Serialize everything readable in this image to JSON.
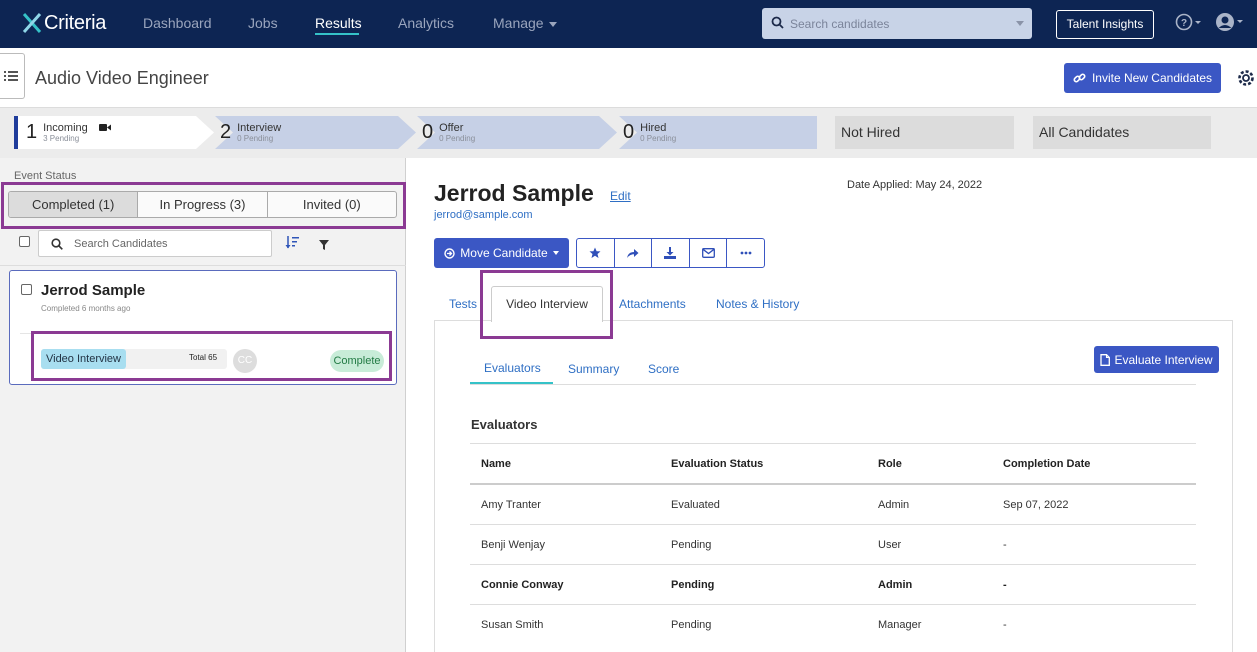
{
  "nav": {
    "brand": "Criteria",
    "items": [
      "Dashboard",
      "Jobs",
      "Results",
      "Analytics",
      "Manage"
    ],
    "active": "Results",
    "search_placeholder": "Search candidates",
    "talent_insights": "Talent Insights"
  },
  "header": {
    "title": "Audio Video Engineer",
    "invite_label": "Invite New Candidates"
  },
  "pipeline": {
    "stages": [
      {
        "count": "1",
        "label": "Incoming",
        "sub": "3 Pending"
      },
      {
        "count": "2",
        "label": "Interview",
        "sub": "0 Pending"
      },
      {
        "count": "0",
        "label": "Offer",
        "sub": "0 Pending"
      },
      {
        "count": "0",
        "label": "Hired",
        "sub": "0 Pending"
      }
    ],
    "not_hired": "Not Hired",
    "all_candidates": "All Candidates"
  },
  "left": {
    "event_status_label": "Event Status",
    "segments": [
      "Completed (1)",
      "In Progress (3)",
      "Invited (0)"
    ],
    "search_placeholder": "Search Candidates",
    "card": {
      "name": "Jerrod Sample",
      "sub": "Completed 6 months ago",
      "tag": "Video Interview",
      "total": "Total 65",
      "initials": "CC",
      "status": "Complete"
    }
  },
  "candidate": {
    "name": "Jerrod Sample",
    "edit": "Edit",
    "email": "jerrod@sample.com",
    "date_applied": "Date Applied: May 24, 2022",
    "move_label": "Move Candidate"
  },
  "tabs": [
    "Tests",
    "Video Interview",
    "Attachments",
    "Notes & History"
  ],
  "subtabs": [
    "Evaluators",
    "Summary",
    "Score"
  ],
  "evaluate_label": "Evaluate Interview",
  "evaluators": {
    "title": "Evaluators",
    "columns": [
      "Name",
      "Evaluation Status",
      "Role",
      "Completion Date"
    ],
    "rows": [
      {
        "name": "Amy Tranter",
        "status": "Evaluated",
        "role": "Admin",
        "date": "Sep 07, 2022"
      },
      {
        "name": "Benji Wenjay",
        "status": "Pending",
        "role": "User",
        "date": "-"
      },
      {
        "name": "Connie Conway",
        "status": "Pending",
        "role": "Admin",
        "date": "-"
      },
      {
        "name": "Susan Smith",
        "status": "Pending",
        "role": "Manager",
        "date": "-"
      }
    ]
  },
  "colors": {
    "nav_bg": "#0d2553",
    "primary": "#3b57c4",
    "highlight": "#8b3a93",
    "accent": "#35c2c8"
  }
}
